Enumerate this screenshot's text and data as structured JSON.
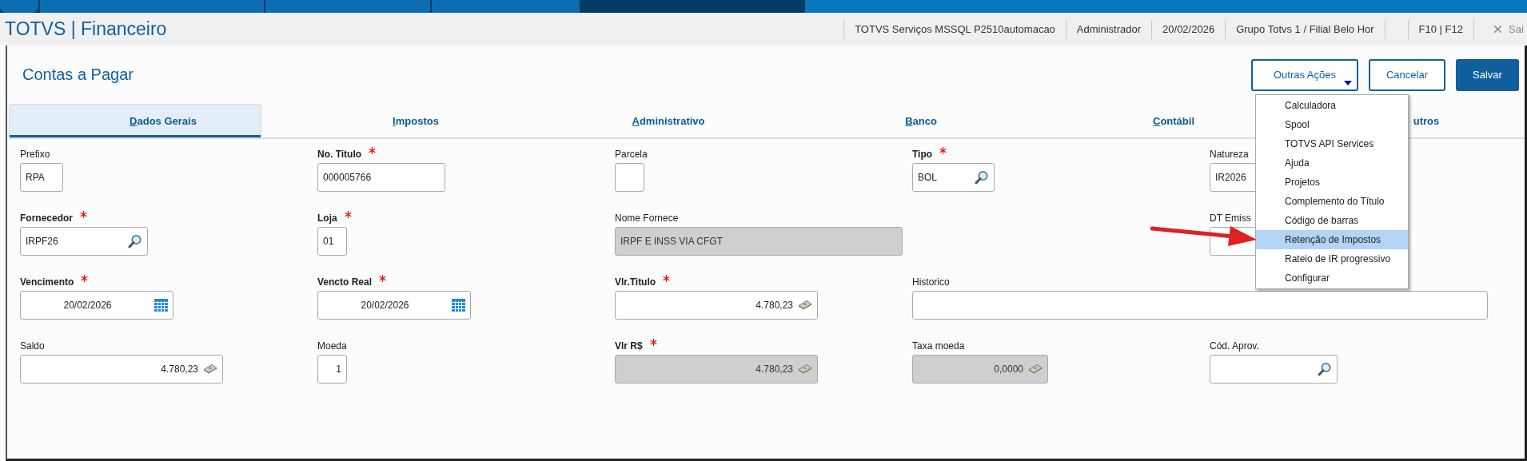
{
  "app": {
    "title": "TOTVS | Financeiro",
    "status_segments": [
      {
        "kind": "text",
        "text": "TOTVS Serviços MSSQL P2510automacao"
      },
      {
        "kind": "text",
        "text": "Administrador"
      },
      {
        "kind": "text",
        "text": "20/02/2026"
      },
      {
        "kind": "text",
        "text": "Grupo Totvs 1 / Filial Belo Hor"
      },
      {
        "kind": "blank"
      },
      {
        "kind": "text",
        "text": "F10 | F12"
      }
    ],
    "exit_label": "Sai"
  },
  "form": {
    "title": "Contas a Pagar",
    "actions": [
      {
        "label": "Outras Ações",
        "kind": "dropdown"
      },
      {
        "label": "Cancelar",
        "kind": "outline"
      },
      {
        "label": "Salvar",
        "kind": "primary"
      }
    ],
    "tabs": [
      {
        "label": "Dados Gerais",
        "selected": true,
        "mnemonic": true
      },
      {
        "label": "Impostos",
        "selected": false,
        "mnemonic": true
      },
      {
        "label": "Administrativo",
        "selected": false,
        "mnemonic": true
      },
      {
        "label": "Banco",
        "selected": false,
        "mnemonic": true
      },
      {
        "label": "Contábil",
        "selected": false,
        "mnemonic": true
      },
      {
        "label": "utros",
        "selected": false,
        "mnemonic": false
      }
    ],
    "rows": [
      [
        {
          "label": "Prefixo",
          "required": false,
          "value": "RPA",
          "kind": "text",
          "disabled": false
        },
        {
          "label": "No. Titulo",
          "required": true,
          "value": "000005766",
          "kind": "text",
          "disabled": false
        },
        {
          "label": "Parcela",
          "required": false,
          "kind": "text",
          "disabled": false
        },
        {
          "label": "Tipo",
          "required": true,
          "value": "BOL",
          "kind": "lookup",
          "disabled": false
        },
        {
          "label": "Natureza",
          "required": false,
          "value": "IR2026",
          "kind": "text",
          "disabled": false
        }
      ],
      [
        {
          "label": "Fornecedor",
          "required": true,
          "value": "IRPF26",
          "kind": "lookup",
          "disabled": false
        },
        {
          "label": "Loja",
          "required": true,
          "value": "01",
          "kind": "text",
          "disabled": false
        },
        {
          "label": "Nome Fornece",
          "required": false,
          "value": "IRPF E INSS VIA CFGT",
          "kind": "text",
          "disabled": true
        },
        null,
        {
          "label": "DT Emiss",
          "required": false,
          "kind": "text",
          "disabled": false
        }
      ],
      [
        {
          "label": "Vencimento",
          "required": true,
          "value": "20/02/2026",
          "kind": "date",
          "disabled": false
        },
        {
          "label": "Vencto Real",
          "required": true,
          "value": "20/02/2026",
          "kind": "date",
          "disabled": false
        },
        {
          "label": "Vlr.Titulo",
          "required": true,
          "value": "4.780,23",
          "kind": "money",
          "disabled": false
        },
        {
          "label": "Historico",
          "required": false,
          "kind": "text",
          "disabled": false
        }
      ],
      [
        {
          "label": "Saldo",
          "required": false,
          "value": "4.780,23",
          "kind": "money",
          "disabled": false
        },
        {
          "label": "Moeda",
          "required": false,
          "value": "1",
          "kind": "number",
          "disabled": false
        },
        {
          "label": "Vlr R$",
          "required": true,
          "value": "4.780,23",
          "kind": "money",
          "disabled": true
        },
        {
          "label": "Taxa moeda",
          "required": false,
          "value": "0,0000",
          "kind": "money",
          "disabled": true
        },
        {
          "label": "Cód. Aprov.",
          "required": false,
          "kind": "lookup",
          "disabled": false
        }
      ]
    ],
    "menu": {
      "items": [
        {
          "label": "Calculadora",
          "selected": false
        },
        {
          "label": "Spool",
          "selected": false
        },
        {
          "label": "TOTVS API Services",
          "selected": false
        },
        {
          "label": "Ajuda",
          "selected": false
        },
        {
          "label": "Projetos",
          "selected": false
        },
        {
          "label": "Complemento do Título",
          "selected": false
        },
        {
          "label": "Código de barras",
          "selected": false
        },
        {
          "label": "Retenção de Impostos",
          "selected": true
        },
        {
          "label": "Rateio de IR progressivo",
          "selected": false
        },
        {
          "label": "Configurar",
          "selected": false
        }
      ]
    }
  }
}
